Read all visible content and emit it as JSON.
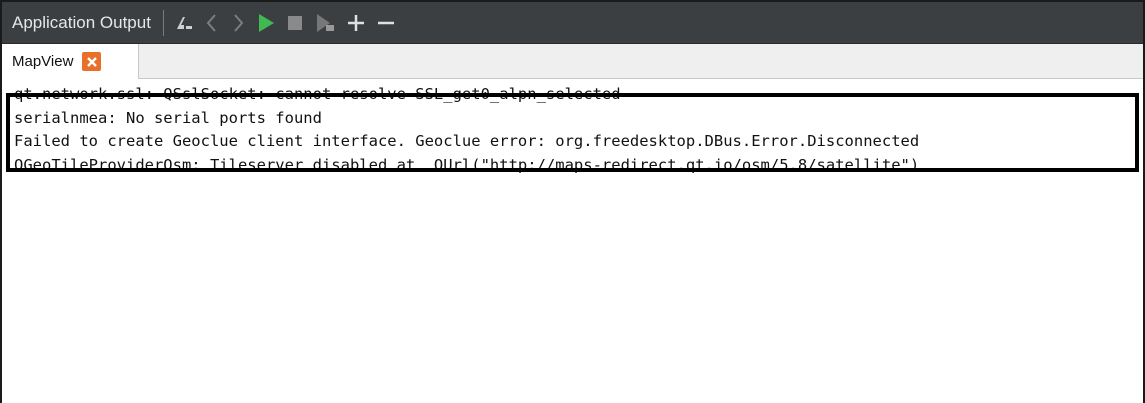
{
  "panel": {
    "title": "Application Output",
    "toolbar_icons": [
      "filter-icon",
      "previous-icon",
      "next-icon",
      "run-icon",
      "stop-icon",
      "attach-icon",
      "zoom-in-icon",
      "zoom-out-icon"
    ]
  },
  "tabs": [
    {
      "label": "MapView",
      "close_icon": "close-icon"
    }
  ],
  "output": {
    "lines": [
      "qt.network.ssl: QSslSocket: cannot resolve SSL_get0_alpn_selected",
      "serialnmea: No serial ports found",
      "Failed to create Geoclue client interface. Geoclue error: org.freedesktop.DBus.Error.Disconnected",
      "QGeoTileProviderOsm: Tileserver disabled at  QUrl(\"http://maps-redirect.qt.io/osm/5.8/satellite\")"
    ]
  },
  "colors": {
    "toolbar_bg": "#3c3f41",
    "run_green": "#3fb950",
    "close_orange": "#e8702a",
    "highlight_border": "#000000"
  }
}
